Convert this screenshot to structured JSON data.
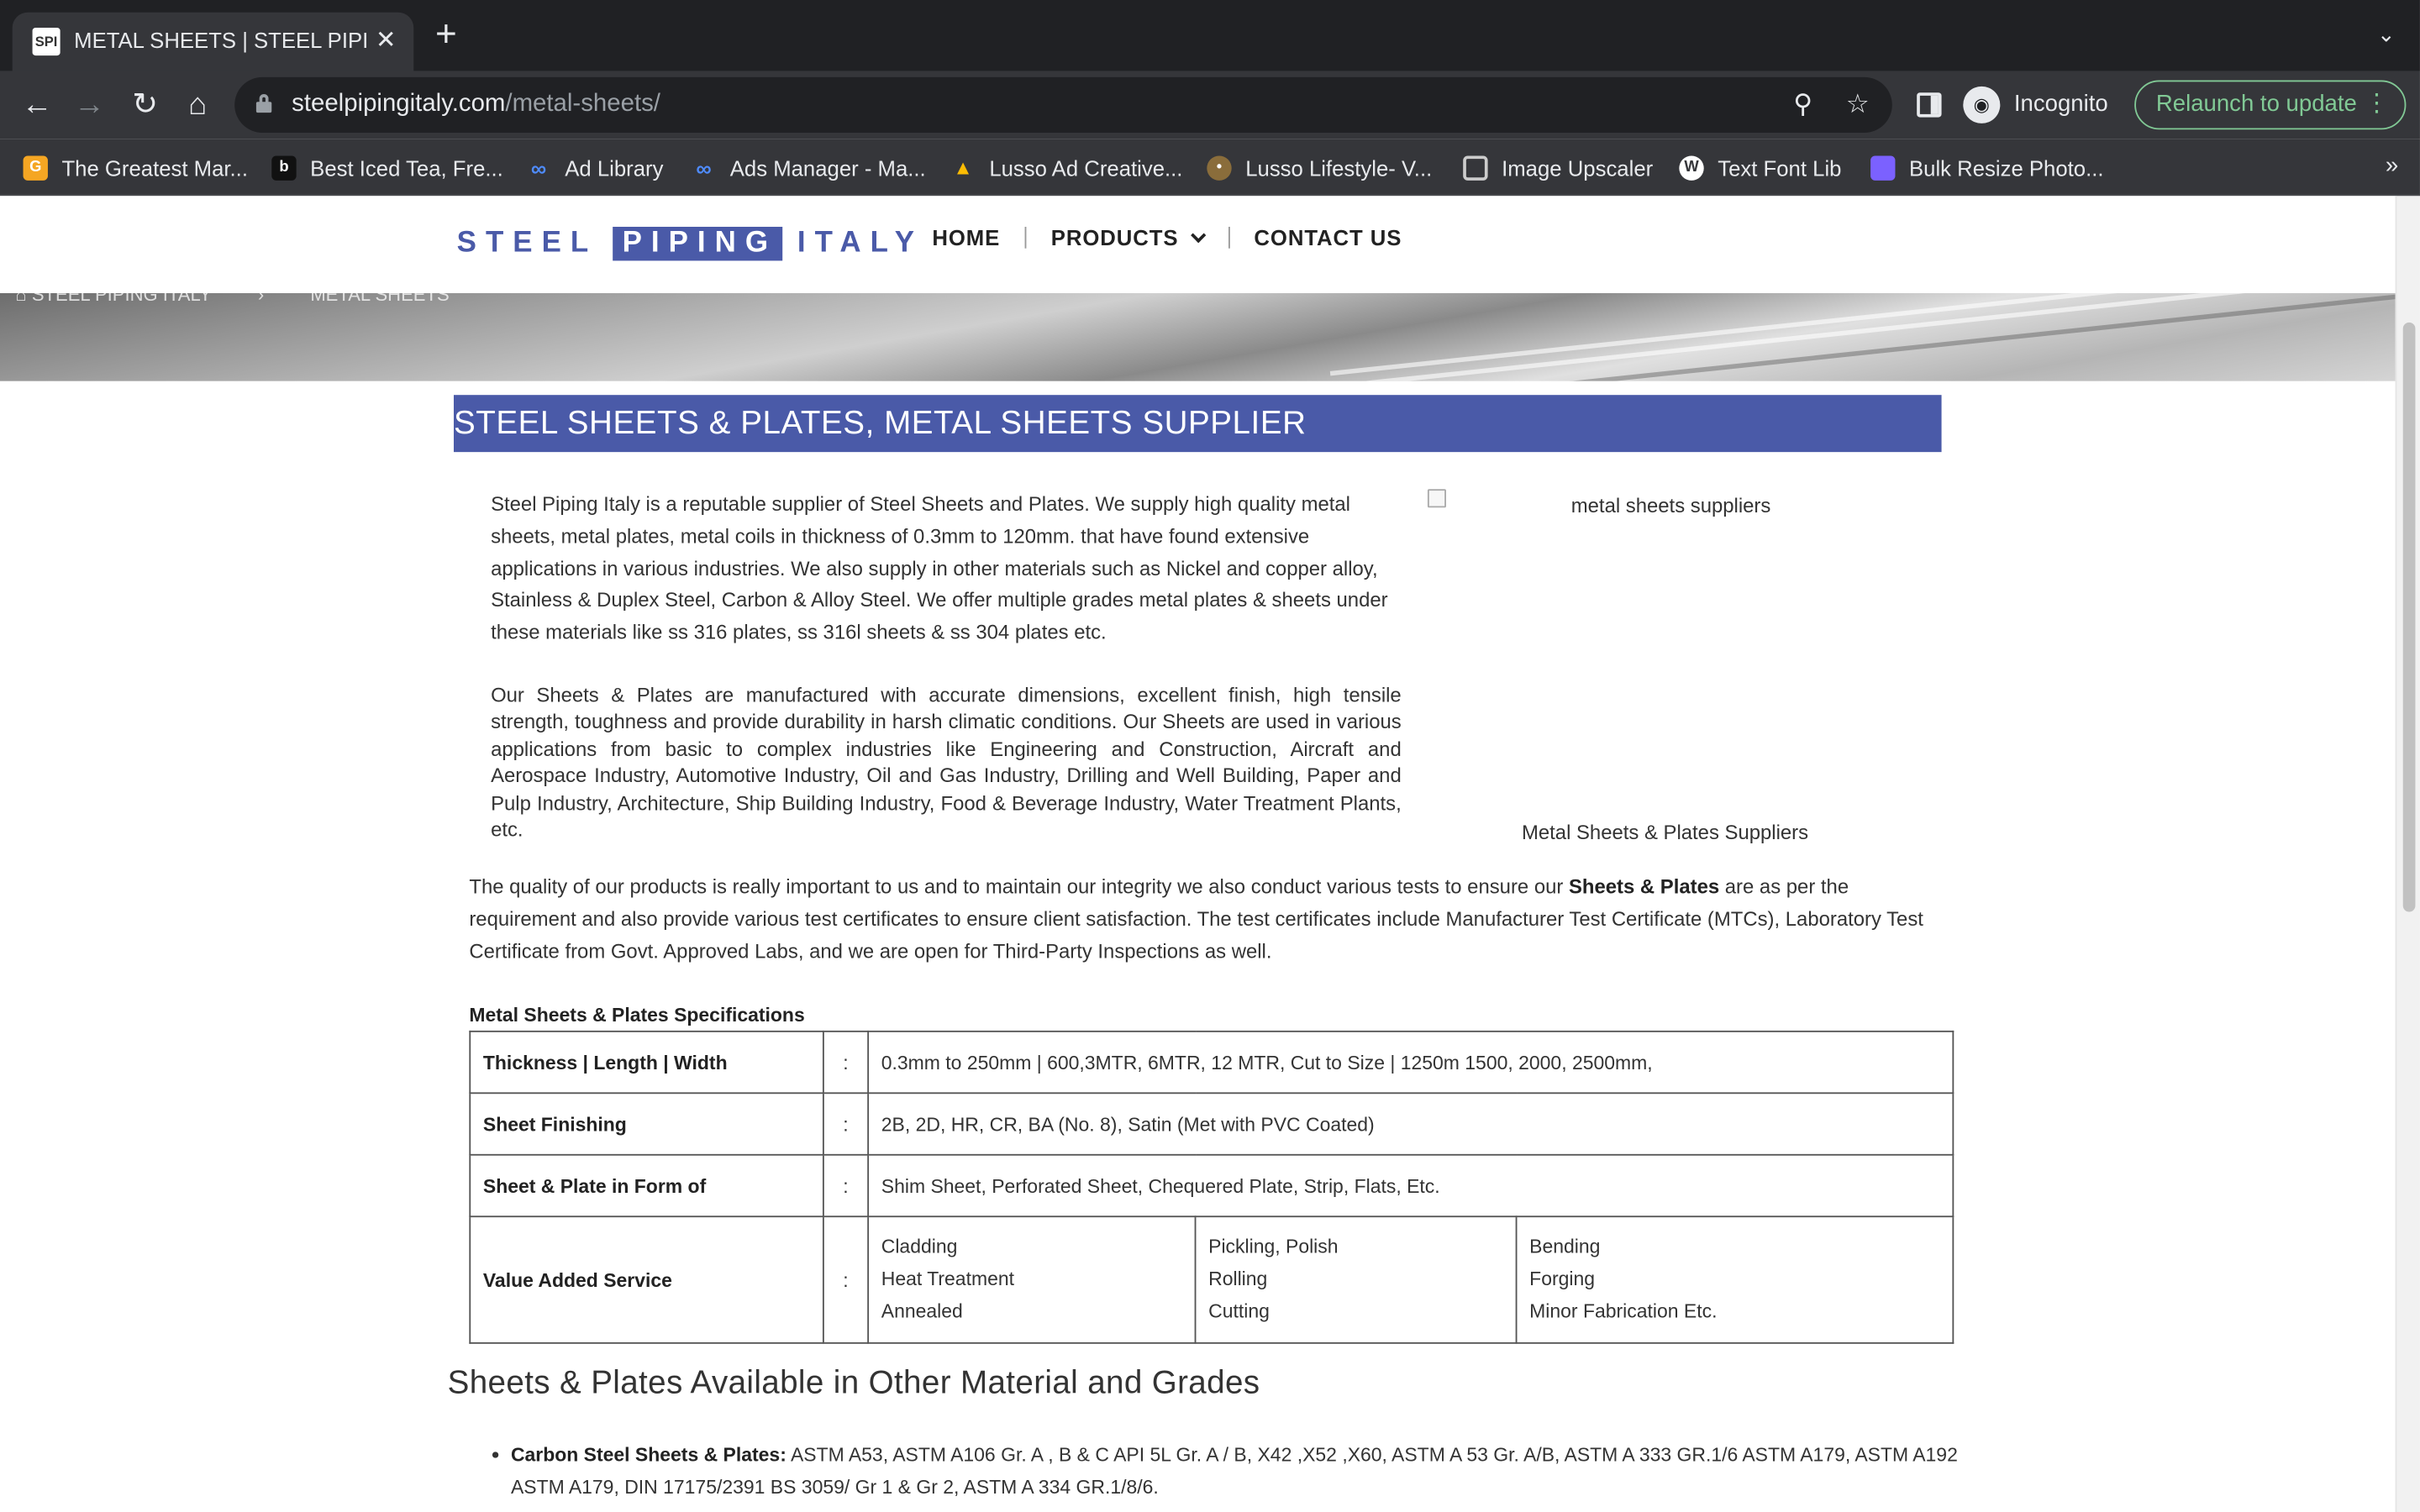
{
  "browser": {
    "tab_title": "METAL SHEETS | STEEL PIPING ITALY",
    "tab_favicon": "SPI",
    "new_tab": "+",
    "url_host": "steelpipingitaly.com",
    "url_path": "/metal-sheets/",
    "profile_label": "Incognito",
    "relaunch_label": "Relaunch to update",
    "bookmarks": [
      {
        "label": "The Greatest Mar...",
        "icon": "G",
        "color": "#f5a623"
      },
      {
        "label": "Best Iced Tea, Fre...",
        "icon": "b",
        "color": "#111111"
      },
      {
        "label": "Ad Library",
        "icon": "meta-icon",
        "color": "#0866ff"
      },
      {
        "label": "Ads Manager - Ma...",
        "icon": "meta-icon",
        "color": "#0866ff"
      },
      {
        "label": "Lusso Ad Creative...",
        "icon": "drive-icon",
        "color": "#34a853"
      },
      {
        "label": "Lusso Lifestyle- V...",
        "icon": "person-icon",
        "color": "#8a6d3b"
      },
      {
        "label": "Image Upscaler",
        "icon": "upscaler-icon",
        "color": "#cccccc"
      },
      {
        "label": "Text Font Lib",
        "icon": "wordpress-icon",
        "color": "#ffffff"
      },
      {
        "label": "Bulk Resize Photo...",
        "icon": "resize-icon",
        "color": "#7b61ff"
      }
    ]
  },
  "header": {
    "logo_left": "STEEL",
    "logo_mid": "PIPING",
    "logo_right": "ITALY",
    "nav": [
      "HOME",
      "PRODUCTS",
      "CONTACT US"
    ]
  },
  "breadcrumb": [
    "STEEL PIPING ITALY",
    "METAL SHEETS"
  ],
  "page": {
    "title": "STEEL SHEETS & PLATES, METAL SHEETS SUPPLIER",
    "intro": "Steel Piping Italy is a reputable supplier of Steel Sheets and Plates. We supply high quality metal sheets, metal plates, metal coils in thickness of 0.3mm to 120mm. that have found extensive applications in various industries. We also supply in other materials such as Nickel and copper alloy, Stainless & Duplex Steel, Carbon & Alloy Steel. We offer multiple grades metal plates & sheets under these materials like ss 316 plates, ss 316l sheets & ss 304 plates etc.",
    "para2": "Our Sheets & Plates are manufactured with accurate dimensions, excellent finish, high tensile strength, toughness and provide durability in harsh climatic conditions. Our Sheets are used in various applications from basic to complex industries like Engineering and Construction, Aircraft and Aerospace Industry, Automotive Industry, Oil and Gas Industry, Drilling and Well Building, Paper and Pulp Industry, Architecture, Ship Building Industry, Food & Beverage Industry, Water Treatment Plants, etc.",
    "image_alt": "metal sheets suppliers",
    "image_caption": "Metal Sheets & Plates Suppliers",
    "quality_pre": "The quality of our products is really important to us and to maintain our integrity we also conduct various tests to ensure our ",
    "quality_bold": "Sheets & Plates",
    "quality_post": " are as per the requirement and also provide various test certificates to ensure client satisfaction. The test certificates include Manufacturer Test Certificate (MTCs), Laboratory Test Certificate from Govt. Approved Labs, and we are open for Third-Party Inspections as well.",
    "spec_title": "Metal Sheets & Plates Specifications",
    "specs": [
      {
        "label": "Thickness | Length | Width",
        "value": "0.3mm to 250mm | 600,3MTR, 6MTR, 12 MTR, Cut to Size | 1250m 1500, 2000, 2500mm,"
      },
      {
        "label": "Sheet Finishing",
        "value": "2B, 2D, HR, CR, BA (No. 8), Satin (Met with PVC Coated)"
      },
      {
        "label": "Sheet & Plate in Form of",
        "value": "Shim Sheet, Perforated Sheet, Chequered Plate, Strip, Flats, Etc."
      }
    ],
    "value_added": {
      "label": "Value Added Service",
      "col1": [
        "Cladding",
        "Heat Treatment",
        "Annealed"
      ],
      "col2": [
        "Pickling, Polish",
        "Rolling",
        "Cutting"
      ],
      "col3": [
        "Bending",
        "Forging",
        "Minor Fabrication Etc."
      ]
    },
    "colon": ":",
    "other_heading": "Sheets & Plates Available in Other Material and Grades",
    "carbon_label": "Carbon Steel Sheets & Plates:",
    "carbon_text": " ASTM A53, ASTM A106 Gr. A , B & C API 5L Gr. A / B, X42 ,X52 ,X60, ASTM A 53 Gr. A/B, ASTM A 333 GR.1/6 ASTM A179, ASTM A192 ASTM A179, DIN 17175/2391 BS 3059/ Gr 1 & Gr 2, ASTM A 334 GR.1/8/6."
  }
}
